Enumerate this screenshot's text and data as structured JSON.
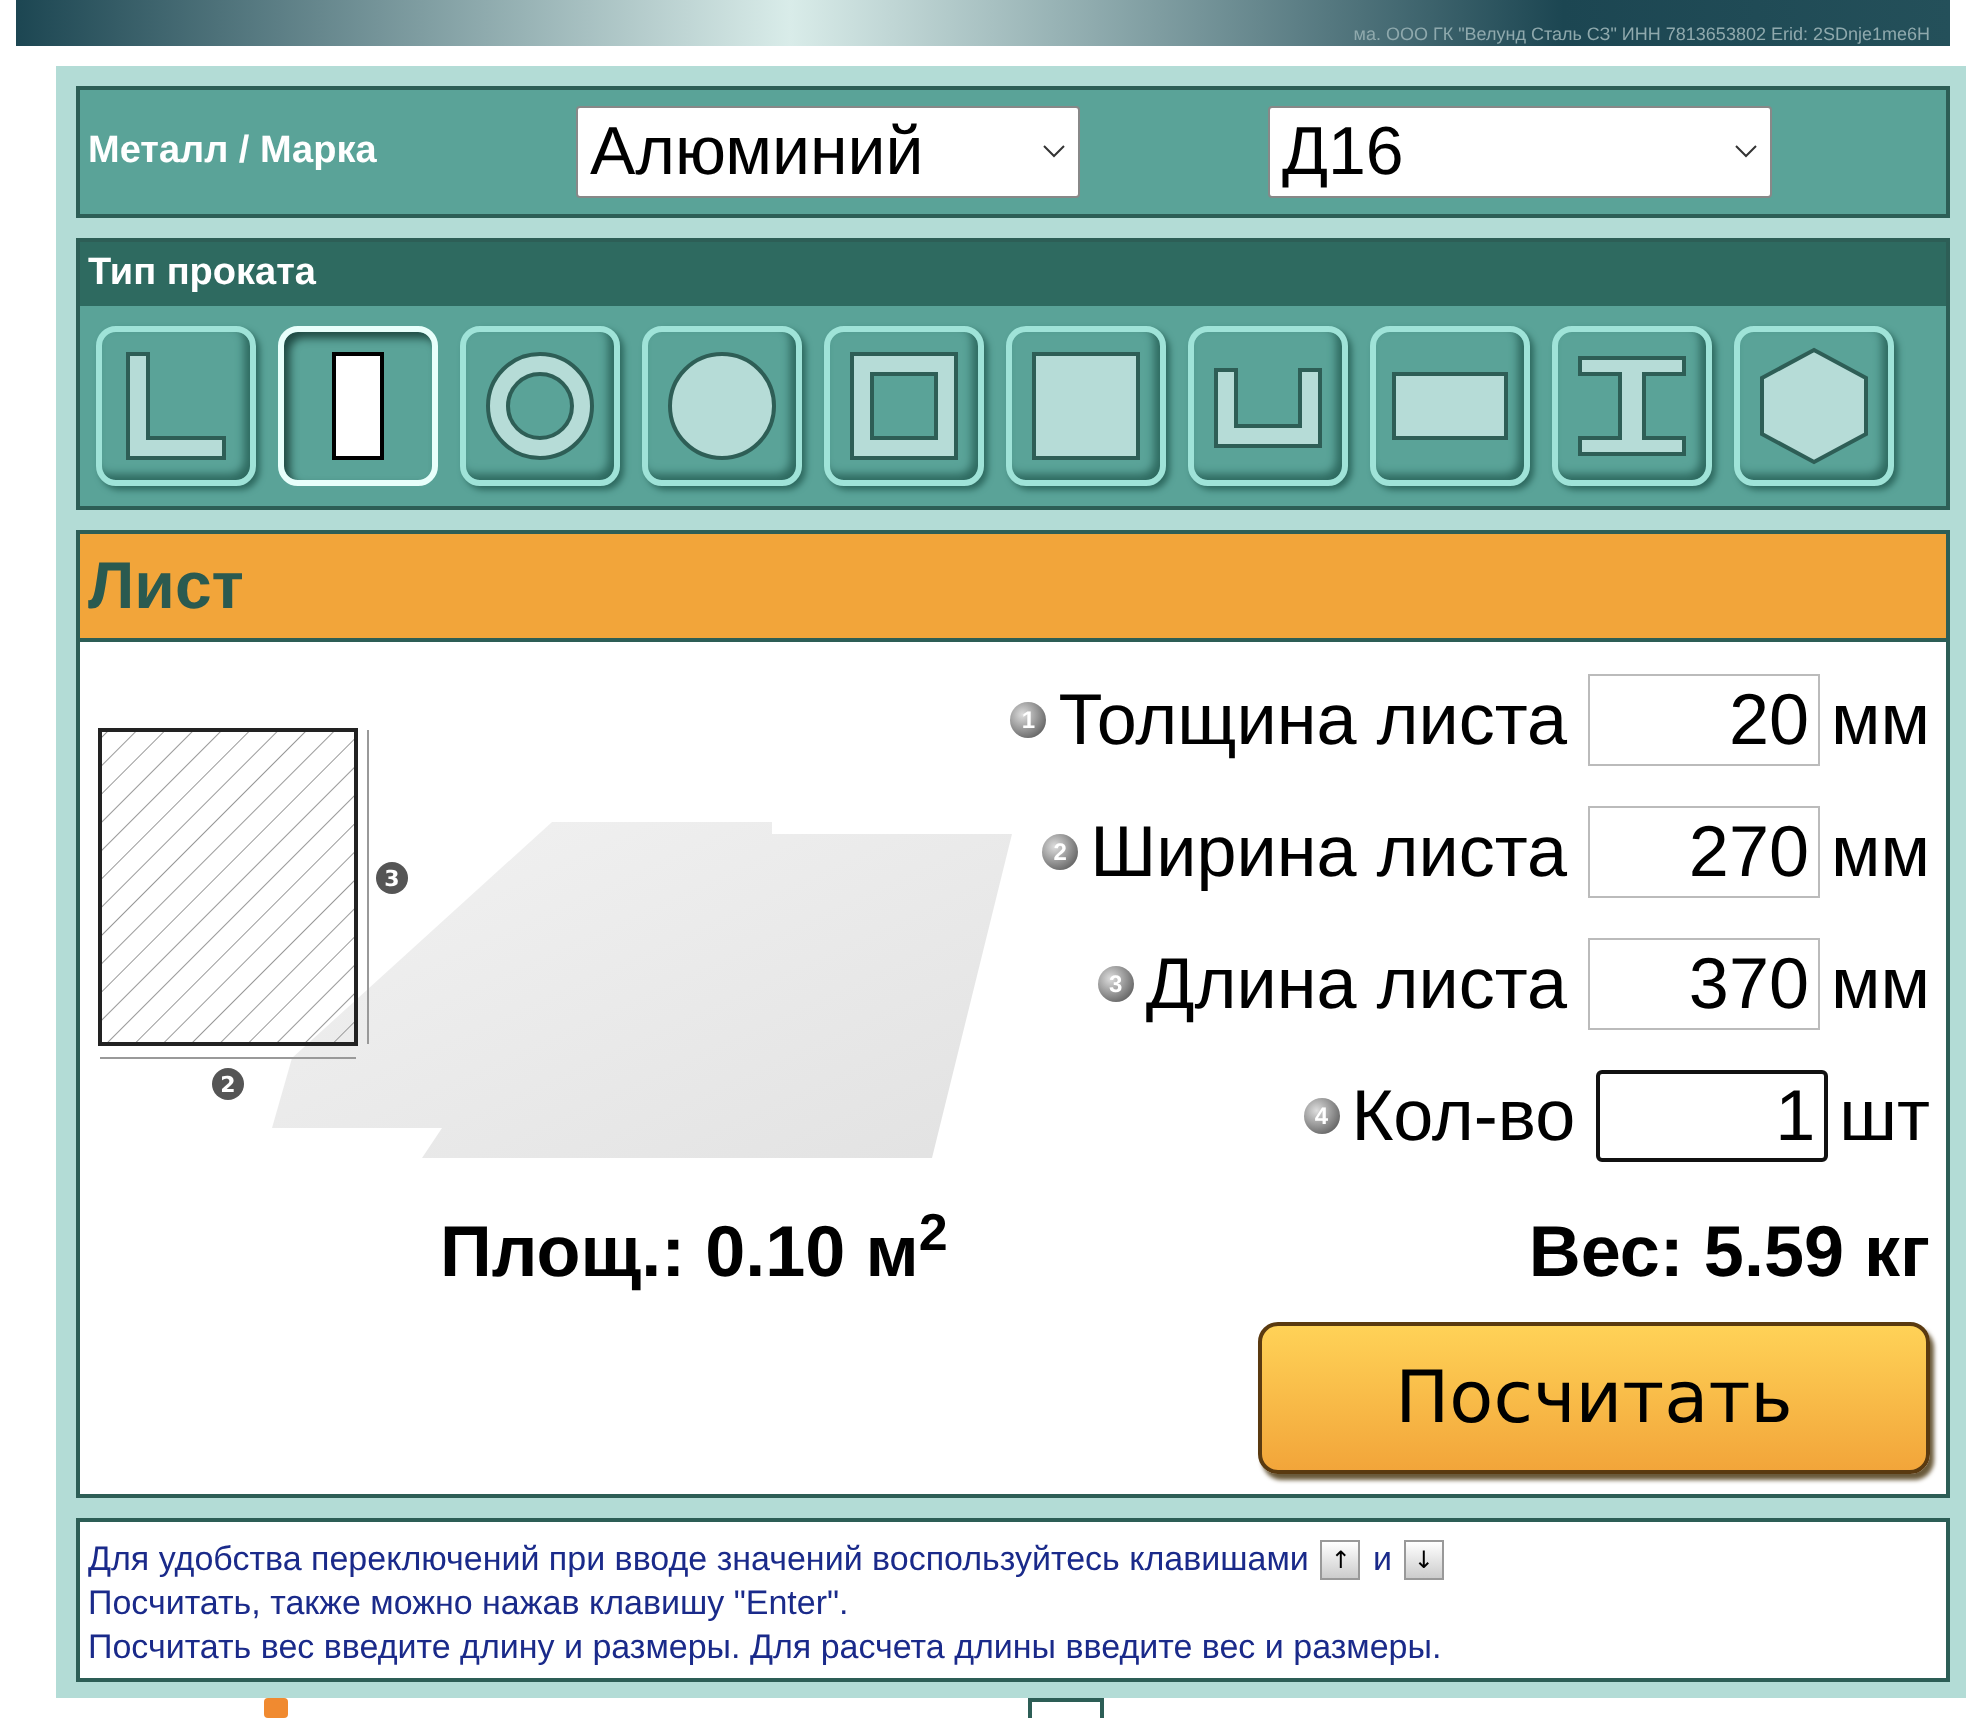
{
  "banner": {
    "text": "ма. ООО ГК \"Велунд Сталь СЗ\" ИНН 7813653802 Erid: 2SDnje1me6H"
  },
  "metal": {
    "label": "Металл / Марка",
    "metal": "Алюминий",
    "grade": "Д16"
  },
  "profile": {
    "title": "Тип проката",
    "types": [
      {
        "kind": "angle",
        "selected": false
      },
      {
        "kind": "strip",
        "selected": true
      },
      {
        "kind": "pipe",
        "selected": false
      },
      {
        "kind": "rod",
        "selected": false
      },
      {
        "kind": "square-tube",
        "selected": false
      },
      {
        "kind": "square-bar",
        "selected": false
      },
      {
        "kind": "channel",
        "selected": false
      },
      {
        "kind": "rect-bar",
        "selected": false
      },
      {
        "kind": "beam",
        "selected": false
      },
      {
        "kind": "hexagon",
        "selected": false
      }
    ]
  },
  "sheet": {
    "title": "Лист",
    "drawing_labels": [
      "3",
      "2"
    ],
    "fields": [
      {
        "number": "1",
        "label": "Толщина листа",
        "value": "20",
        "unit": "мм",
        "focused": false
      },
      {
        "number": "2",
        "label": "Ширина листа",
        "value": "270",
        "unit": "мм",
        "focused": false
      },
      {
        "number": "3",
        "label": "Длина листа",
        "value": "370",
        "unit": "мм",
        "focused": false
      },
      {
        "number": "4",
        "label": "Кол-во",
        "value": "1",
        "unit": "шт",
        "focused": true
      }
    ],
    "area": "Площ.: 0.10 м$^{2}$",
    "weight": "Вес: 5.59 кг",
    "button": "Посчитать"
  },
  "notes": {
    "line1": "Для удобства переключений при вводе значений воспользуйтесь клавишами",
    "key_up": "↑",
    "joiner": "и",
    "key_down": "↓",
    "lines": [
      "Посчитать, также можно нажав клавишу \"Enter\".",
      "Посчитать вес введите длину и размеры. Для расчета длины введите вес и размеры."
    ]
  }
}
